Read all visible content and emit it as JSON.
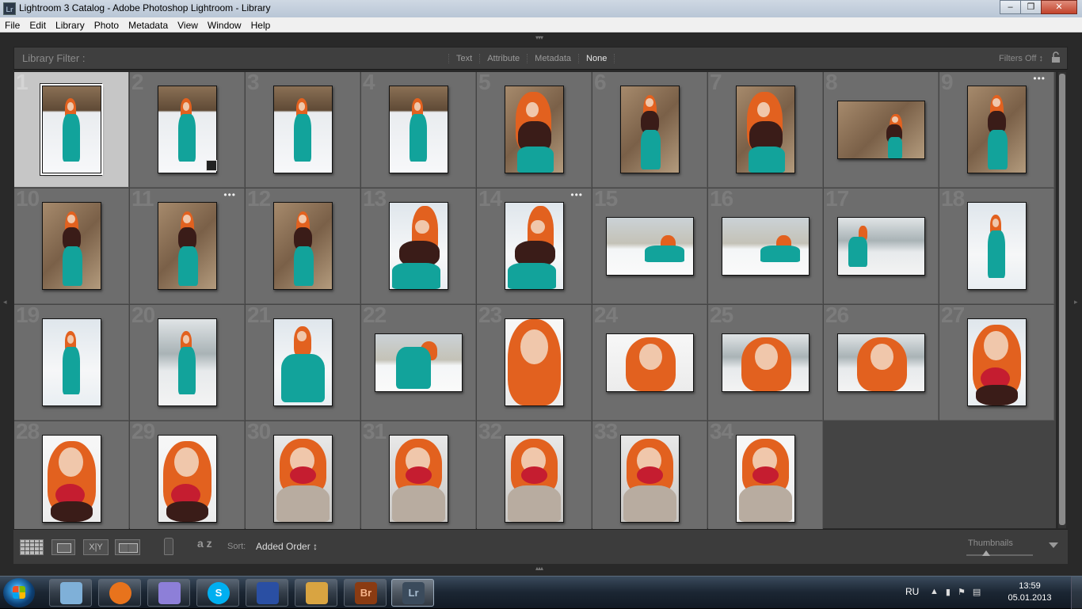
{
  "window": {
    "title": "Lightroom 3 Catalog - Adobe Photoshop Lightroom - Library",
    "app_icon_label": "Lr",
    "buttons": {
      "minimize": "–",
      "restore": "❐",
      "close": "✕"
    }
  },
  "menu": [
    "File",
    "Edit",
    "Library",
    "Photo",
    "Metadata",
    "View",
    "Window",
    "Help"
  ],
  "filter_bar": {
    "label": "Library Filter :",
    "options": [
      "Text",
      "Attribute",
      "Metadata",
      "None"
    ],
    "active": "None",
    "filters_status": "Filters Off ↕"
  },
  "photos": [
    {
      "n": "1",
      "o": "portrait",
      "scene": "field",
      "subject": "full-dress",
      "selected": true
    },
    {
      "n": "2",
      "o": "portrait",
      "scene": "field",
      "subject": "full-dress",
      "badge": true
    },
    {
      "n": "3",
      "o": "portrait",
      "scene": "field",
      "subject": "full-dress"
    },
    {
      "n": "4",
      "o": "portrait",
      "scene": "field",
      "subject": "full-dress"
    },
    {
      "n": "5",
      "o": "portrait",
      "scene": "reeds",
      "subject": "shawl-mid"
    },
    {
      "n": "6",
      "o": "portrait",
      "scene": "reeds",
      "subject": "shawl-full"
    },
    {
      "n": "7",
      "o": "portrait",
      "scene": "reeds",
      "subject": "shawl-mid"
    },
    {
      "n": "8",
      "o": "landscape",
      "scene": "reeds",
      "subject": "shawl-far"
    },
    {
      "n": "9",
      "o": "portrait",
      "scene": "reeds",
      "subject": "shawl-full",
      "dots": true
    },
    {
      "n": "10",
      "o": "portrait",
      "scene": "reeds",
      "subject": "shawl-full"
    },
    {
      "n": "11",
      "o": "portrait",
      "scene": "reeds",
      "subject": "shawl-full",
      "dots": true
    },
    {
      "n": "12",
      "o": "portrait",
      "scene": "reeds",
      "subject": "shawl-full"
    },
    {
      "n": "13",
      "o": "portrait",
      "scene": "snow",
      "subject": "sitting-shawl"
    },
    {
      "n": "14",
      "o": "portrait",
      "scene": "snow",
      "subject": "sitting-shawl",
      "dots": true
    },
    {
      "n": "15",
      "o": "landscape",
      "scene": "trees",
      "subject": "lying"
    },
    {
      "n": "16",
      "o": "landscape",
      "scene": "trees",
      "subject": "lying"
    },
    {
      "n": "17",
      "o": "landscape",
      "scene": "water",
      "subject": "standing-small"
    },
    {
      "n": "18",
      "o": "portrait",
      "scene": "snow",
      "subject": "full-dress"
    },
    {
      "n": "19",
      "o": "portrait",
      "scene": "snow",
      "subject": "full-dress"
    },
    {
      "n": "20",
      "o": "portrait",
      "scene": "water",
      "subject": "full-dress"
    },
    {
      "n": "21",
      "o": "portrait",
      "scene": "snow",
      "subject": "sitting"
    },
    {
      "n": "22",
      "o": "landscape",
      "scene": "trees",
      "subject": "bending"
    },
    {
      "n": "23",
      "o": "portrait",
      "scene": "white",
      "subject": "closeup-hair"
    },
    {
      "n": "24",
      "o": "landscape",
      "scene": "white",
      "subject": "closeup-wide"
    },
    {
      "n": "25",
      "o": "landscape",
      "scene": "water",
      "subject": "closeup-wide"
    },
    {
      "n": "26",
      "o": "landscape",
      "scene": "water",
      "subject": "closeup-wide"
    },
    {
      "n": "27",
      "o": "portrait",
      "scene": "snow",
      "subject": "closeup-roses"
    },
    {
      "n": "28",
      "o": "portrait",
      "scene": "white",
      "subject": "closeup-roses"
    },
    {
      "n": "29",
      "o": "portrait",
      "scene": "white",
      "subject": "closeup-roses"
    },
    {
      "n": "30",
      "o": "portrait",
      "scene": "close",
      "subject": "coat-roses"
    },
    {
      "n": "31",
      "o": "portrait",
      "scene": "close",
      "subject": "coat-roses"
    },
    {
      "n": "32",
      "o": "portrait",
      "scene": "close",
      "subject": "coat-roses"
    },
    {
      "n": "33",
      "o": "portrait",
      "scene": "close",
      "subject": "coat-roses"
    },
    {
      "n": "34",
      "o": "portrait",
      "scene": "white",
      "subject": "coat-roses"
    }
  ],
  "toolbar": {
    "compare_label": "X|Y",
    "sort_icon_label": "a z",
    "sort_label": "Sort:",
    "sort_value": "Added Order ↕",
    "thumbnails_label": "Thumbnails",
    "thumbnail_size": 0.3
  },
  "taskbar": {
    "apps": [
      {
        "name": "explorer",
        "label": "",
        "color": "#7fb0d8"
      },
      {
        "name": "firefox",
        "label": "",
        "color": "#e8731c"
      },
      {
        "name": "paint-tool",
        "label": "",
        "color": "#8d7fd8"
      },
      {
        "name": "skype",
        "label": "S",
        "color": "#00aff0"
      },
      {
        "name": "save-tool",
        "label": "",
        "color": "#2a4fa3"
      },
      {
        "name": "paint",
        "label": "",
        "color": "#d9a441"
      },
      {
        "name": "bridge",
        "label": "Br",
        "color": "#8a3b12"
      },
      {
        "name": "lightroom",
        "label": "Lr",
        "color": "#3b4b5c",
        "active": true
      }
    ],
    "language": "RU",
    "time": "13:59",
    "date": "05.01.2013"
  }
}
